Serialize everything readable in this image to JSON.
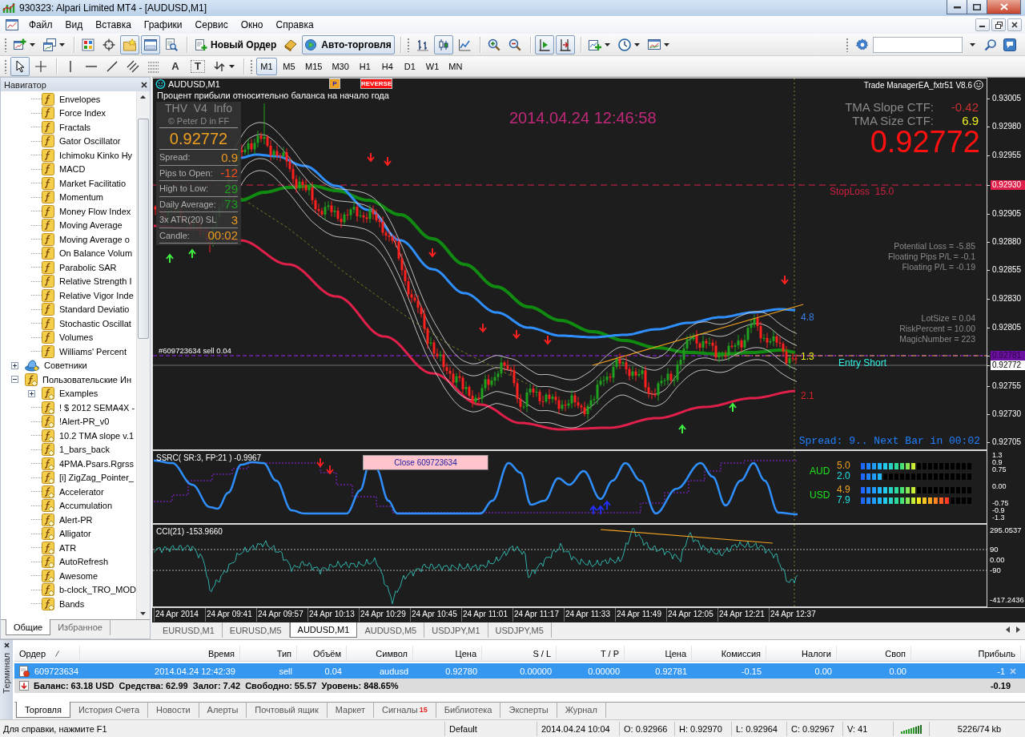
{
  "window": {
    "title": "930323: Alpari Limited MT4 - [AUDUSD,M1]"
  },
  "menu": [
    "Файл",
    "Вид",
    "Вставка",
    "Графики",
    "Сервис",
    "Окно",
    "Справка"
  ],
  "toolbar": {
    "groups": [
      [
        {
          "kind": "new-chart",
          "pressed": false,
          "dropdown": true
        },
        {
          "kind": "profiles",
          "pressed": false,
          "dropdown": true
        }
      ],
      [
        {
          "kind": "market-watch",
          "pressed": false
        },
        {
          "kind": "data-window",
          "pressed": false
        },
        {
          "kind": "navigator",
          "pressed": true
        },
        {
          "kind": "terminal",
          "pressed": true
        },
        {
          "kind": "tester",
          "pressed": false
        }
      ],
      [
        {
          "kind": "new-order",
          "label": "Новый Ордер",
          "pressed": false
        },
        {
          "kind": "editor",
          "pressed": false
        },
        {
          "kind": "auto-trading",
          "label": "Авто-торговля",
          "pressed": true
        }
      ],
      [
        {
          "kind": "bar-chart",
          "pressed": false
        },
        {
          "kind": "candles",
          "pressed": true
        },
        {
          "kind": "line-chart",
          "pressed": false
        }
      ],
      [
        {
          "kind": "zoom-in",
          "pressed": false
        },
        {
          "kind": "zoom-out",
          "pressed": false
        }
      ],
      [
        {
          "kind": "chart-shift",
          "pressed": true
        },
        {
          "kind": "autoscroll",
          "pressed": true
        }
      ],
      [
        {
          "kind": "indicators",
          "pressed": false,
          "dropdown": true
        },
        {
          "kind": "periods",
          "pressed": false,
          "dropdown": true
        },
        {
          "kind": "templates",
          "pressed": false,
          "dropdown": true
        }
      ]
    ]
  },
  "drawing_toolbar": {
    "tools": [
      {
        "kind": "cursor",
        "pressed": true
      },
      {
        "kind": "crosshair",
        "pressed": false
      },
      {
        "kind": "vertical-line",
        "pressed": false
      },
      {
        "kind": "horizontal-line",
        "pressed": false
      },
      {
        "kind": "trendline",
        "pressed": false
      },
      {
        "kind": "channel",
        "pressed": false
      },
      {
        "kind": "fibonacci",
        "pressed": false
      },
      {
        "kind": "text",
        "label": "A",
        "pressed": false
      },
      {
        "kind": "text-label",
        "label": "T",
        "pressed": false
      },
      {
        "kind": "arrows",
        "pressed": false,
        "dropdown": true
      }
    ],
    "timeframes": [
      {
        "label": "M1",
        "selected": true
      },
      {
        "label": "M5",
        "selected": false
      },
      {
        "label": "M15",
        "selected": false
      },
      {
        "label": "M30",
        "selected": false
      },
      {
        "label": "H1",
        "selected": false
      },
      {
        "label": "H4",
        "selected": false
      },
      {
        "label": "D1",
        "selected": false
      },
      {
        "label": "W1",
        "selected": false
      },
      {
        "label": "MN",
        "selected": false
      }
    ]
  },
  "navigator": {
    "title": "Навигатор",
    "tree": [
      {
        "children": [
          {
            "label": "Envelopes",
            "kind": "indicator"
          },
          {
            "label": "Force Index",
            "kind": "indicator"
          },
          {
            "label": "Fractals",
            "kind": "indicator"
          },
          {
            "label": "Gator Oscillator",
            "kind": "indicator"
          },
          {
            "label": "Ichimoku Kinko Hy",
            "kind": "indicator"
          },
          {
            "label": "MACD",
            "kind": "indicator"
          },
          {
            "label": "Market Facilitatio",
            "kind": "indicator"
          },
          {
            "label": "Momentum",
            "kind": "indicator"
          },
          {
            "label": "Money Flow Index",
            "kind": "indicator"
          },
          {
            "label": "Moving Average",
            "kind": "indicator"
          },
          {
            "label": "Moving Average o",
            "kind": "indicator"
          },
          {
            "label": "On Balance Volum",
            "kind": "indicator"
          },
          {
            "label": "Parabolic SAR",
            "kind": "indicator"
          },
          {
            "label": "Relative Strength I",
            "kind": "indicator"
          },
          {
            "label": "Relative Vigor Inde",
            "kind": "indicator"
          },
          {
            "label": "Standard Deviatio",
            "kind": "indicator"
          },
          {
            "label": "Stochastic Oscillat",
            "kind": "indicator"
          },
          {
            "label": "Volumes",
            "kind": "indicator"
          },
          {
            "label": "Williams' Percent",
            "kind": "indicator"
          }
        ]
      },
      {
        "label": "Советники",
        "kind": "advisors",
        "expanded": false
      },
      {
        "label": "Пользовательские Ин",
        "kind": "custom",
        "expanded": true,
        "children": [
          {
            "label": "Examples",
            "kind": "custom",
            "expanded": false
          },
          {
            "label": "! $ 2012 SEMA4X -",
            "kind": "custom"
          },
          {
            "label": "!Alert-PR_v0",
            "kind": "custom"
          },
          {
            "label": "10.2 TMA slope v.1",
            "kind": "custom"
          },
          {
            "label": "1_bars_back",
            "kind": "custom"
          },
          {
            "label": "4PMA.Psars.Rgrss",
            "kind": "custom"
          },
          {
            "label": "[i] ZigZag_Pointer_",
            "kind": "custom"
          },
          {
            "label": "Accelerator",
            "kind": "custom"
          },
          {
            "label": "Accumulation",
            "kind": "custom"
          },
          {
            "label": "Alert-PR",
            "kind": "custom"
          },
          {
            "label": "Alligator",
            "kind": "custom"
          },
          {
            "label": "ATR",
            "kind": "custom"
          },
          {
            "label": "AutoRefresh",
            "kind": "custom"
          },
          {
            "label": "Awesome",
            "kind": "custom"
          },
          {
            "label": "b-clock_TRO_MOD",
            "kind": "custom"
          },
          {
            "label": "Bands",
            "kind": "custom"
          }
        ]
      }
    ],
    "tabs": [
      {
        "label": "Общие",
        "selected": true
      },
      {
        "label": "Избранное",
        "selected": false
      }
    ]
  },
  "chart": {
    "symbol": "AUDUSD,M1",
    "p_button": "P",
    "reverse_button": "REVERSE",
    "caption": "Процент прибыли относительно баланса на начало года",
    "info_panel": {
      "title": "THV  V4  Info",
      "credit": "© Peter D in FF",
      "price": "0.92772",
      "rows": [
        {
          "label": "Spread:",
          "value": "0.9",
          "color": "#e89a20"
        },
        {
          "label": "Pips to Open:",
          "value": "-12",
          "color": "#ff4a20"
        },
        {
          "label": "High to Low:",
          "value": "29",
          "color": "#1e9e1e"
        },
        {
          "label": "Daily Average:",
          "value": "73",
          "color": "#1e9e1e"
        },
        {
          "label": "3x ATR(20) SL",
          "value": "3",
          "color": "#e89a20"
        },
        {
          "label": "Candle:",
          "value": "00:02",
          "color": "#e89a20"
        }
      ]
    },
    "timestamp": "2014.04.24 12:46:58",
    "ea_title": "Trade ManagerEA_fxtr51 V8.6",
    "tma": [
      {
        "label": "TMA Slope CTF:",
        "value": "-0.42",
        "color": "#c83030"
      },
      {
        "label": "TMA Size CTF:",
        "value": "6.9",
        "color": "#f0f020"
      }
    ],
    "big_price": "0.92772",
    "stop_loss": "StopLoss  15.0",
    "pl_stats": [
      "Potential Loss = -5.85",
      "Floating Pips P/L = -0.1",
      "Floating P/L = -0.19"
    ],
    "settings": [
      "LotSize = 0.04",
      "RiskPercent = 10.00",
      "MagicNumber = 223"
    ],
    "band_values": [
      {
        "text": "4.8",
        "color": "#3a7ee8"
      },
      {
        "text": "1.3",
        "color": "#f0f020"
      },
      {
        "text": "2.1",
        "color": "#e02020"
      }
    ],
    "entry_label": "Entry Short",
    "order_label": "#609723634 sell 0.04",
    "spread_line": "Spread: 9.. Next Bar in 00:02",
    "price_axis": [
      {
        "label": "0.93005",
        "kind": "tick"
      },
      {
        "label": "0.92980",
        "kind": "tick"
      },
      {
        "label": "0.92955",
        "kind": "tick"
      },
      {
        "label": "0.92930",
        "kind": "stop"
      },
      {
        "label": "0.92905",
        "kind": "tick"
      },
      {
        "label": "0.92880",
        "kind": "tick"
      },
      {
        "label": "0.92855",
        "kind": "tick"
      },
      {
        "label": "0.92830",
        "kind": "tick"
      },
      {
        "label": "0.92805",
        "kind": "tick"
      },
      {
        "label": "0.92781",
        "kind": "entry"
      },
      {
        "label": "0.92772",
        "kind": "bid"
      },
      {
        "label": "0.92755",
        "kind": "tick"
      },
      {
        "label": "0.92730",
        "kind": "tick"
      },
      {
        "label": "0.92705",
        "kind": "tick"
      }
    ]
  },
  "oscillator": {
    "title": "SSRC( SR:3, FP:21 ) -0.9967",
    "close_button": "Close 609723634",
    "currencies": [
      {
        "name": "AUD",
        "meters": [
          {
            "reading": "5.0",
            "color": "#f0a020",
            "level": 0.5
          },
          {
            "reading": "2.0",
            "color": "#20e0e0",
            "level": 0.2
          }
        ]
      },
      {
        "name": "USD",
        "meters": [
          {
            "reading": "4.9",
            "color": "#f0a020",
            "level": 0.49
          },
          {
            "reading": "7.9",
            "color": "#20e0e0",
            "level": 0.79
          }
        ]
      }
    ],
    "axis": [
      "1.3",
      "0.9",
      "0.75",
      "0.00",
      "-0.75",
      "-0.9",
      "-1.3"
    ]
  },
  "cci": {
    "title": "CCI(21) -153.9660",
    "axis": [
      "295.0537",
      "90",
      "0.00",
      "-90",
      "-417.2436"
    ]
  },
  "time_axis": [
    "24 Apr 2014",
    "24 Apr 09:41",
    "24 Apr 09:57",
    "24 Apr 10:13",
    "24 Apr 10:29",
    "24 Apr 10:45",
    "24 Apr 11:01",
    "24 Apr 11:17",
    "24 Apr 11:33",
    "24 Apr 11:49",
    "24 Apr 12:05",
    "24 Apr 12:21",
    "24 Apr 12:37"
  ],
  "chart_tabs": [
    {
      "label": "EURUSD,M1",
      "selected": false
    },
    {
      "label": "EURUSD,M5",
      "selected": false
    },
    {
      "label": "AUDUSD,M1",
      "selected": true
    },
    {
      "label": "AUDUSD,M5",
      "selected": false
    },
    {
      "label": "USDJPY,M1",
      "selected": false
    },
    {
      "label": "USDJPY,M5",
      "selected": false
    }
  ],
  "terminal": {
    "title": "Терминал",
    "columns": [
      "Ордер",
      "Время",
      "Тип",
      "Объём",
      "Символ",
      "Цена",
      "S / L",
      "T / P",
      "Цена",
      "Комиссия",
      "Налоги",
      "Своп",
      "Прибыль"
    ],
    "rows": [
      {
        "cells": [
          "609723634",
          "2014.04.24 12:42:39",
          "sell",
          "0.04",
          "audusd",
          "0.92780",
          "0.00000",
          "0.00000",
          "0.92781",
          "-0.15",
          "0.00",
          "0.00",
          "-1"
        ],
        "selected": true
      }
    ],
    "summary": "Баланс: 63.18 USD  Средства: 62.99  Залог: 7.42  Свободно: 55.57  Уровень: 848.65%",
    "summary_total": "-0.19",
    "tabs": [
      {
        "label": "Торговля",
        "selected": true
      },
      {
        "label": "История Счета",
        "selected": false
      },
      {
        "label": "Новости",
        "selected": false
      },
      {
        "label": "Алерты",
        "selected": false
      },
      {
        "label": "Почтовый ящик",
        "selected": false
      },
      {
        "label": "Маркет",
        "selected": false
      },
      {
        "label": "Сигналы",
        "badge": "15",
        "selected": false
      },
      {
        "label": "Библиотека",
        "selected": false
      },
      {
        "label": "Эксперты",
        "selected": false
      },
      {
        "label": "Журнал",
        "selected": false
      }
    ]
  },
  "status_bar": {
    "help": "Для справки, нажмите F1",
    "profile": "Default",
    "time": "2014.04.24 10:04",
    "open": "O: 0.92966",
    "high": "H: 0.92970",
    "low": "L: 0.92964",
    "close": "C: 0.92967",
    "volume": "V: 41",
    "traffic": "5226/74 kb"
  }
}
